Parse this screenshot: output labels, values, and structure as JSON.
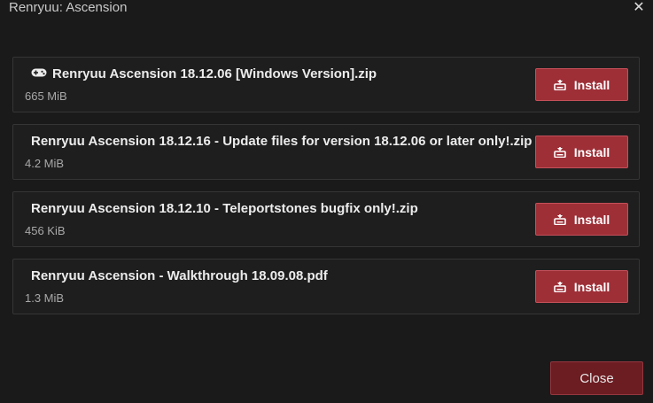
{
  "window": {
    "title": "Renryuu: Ascension",
    "close_glyph": "✕"
  },
  "files": [
    {
      "name": "Renryuu Ascension 18.12.06 [Windows Version].zip",
      "size": "665 MiB",
      "icon": "gamepad-icon",
      "install_label": "Install"
    },
    {
      "name": "Renryuu Ascension 18.12.16 - Update files for version 18.12.06 or later only!.zip",
      "size": "4.2 MiB",
      "icon": "",
      "install_label": "Install"
    },
    {
      "name": "Renryuu Ascension 18.12.10 - Teleportstones bugfix only!.zip",
      "size": "456 KiB",
      "icon": "",
      "install_label": "Install"
    },
    {
      "name": "Renryuu Ascension - Walkthrough 18.09.08.pdf",
      "size": "1.3 MiB",
      "icon": "",
      "install_label": "Install"
    }
  ],
  "footer": {
    "close_label": "Close"
  },
  "colors": {
    "background": "#1a1a1a",
    "row_border": "#353535",
    "install_button": "#9e2f37",
    "close_button": "#6c1d22"
  }
}
